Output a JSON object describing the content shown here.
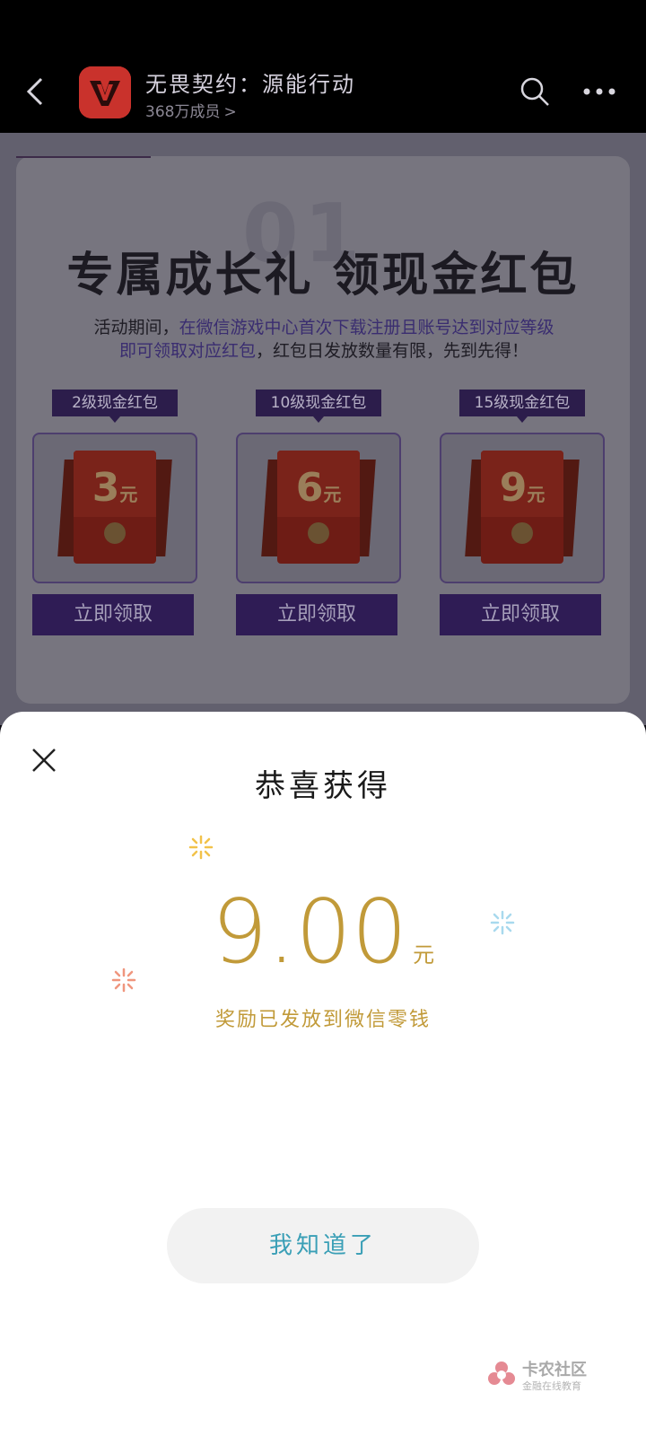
{
  "header": {
    "title": "无畏契约：源能行动",
    "members": "368万成员",
    "members_chevron": ">"
  },
  "event": {
    "big_number": "01",
    "title": "专属成长礼 领现金红包",
    "desc_prefix": "活动期间，",
    "desc_highlight_1": "在微信游戏中心首次下载注册且账号达到对应等级",
    "desc_highlight_2": "即可领取对应红包",
    "desc_suffix": "，红包日发放数量有限，先到先得！",
    "rewards": [
      {
        "tag": "2级现金红包",
        "amount": "3",
        "unit": "元",
        "button": "立即领取"
      },
      {
        "tag": "10级现金红包",
        "amount": "6",
        "unit": "元",
        "button": "立即领取"
      },
      {
        "tag": "15级现金红包",
        "amount": "9",
        "unit": "元",
        "button": "立即领取"
      }
    ]
  },
  "sheet": {
    "title": "恭喜获得",
    "amount": "9.00",
    "unit": "元",
    "subtitle": "奖励已发放到微信零钱",
    "ok_button": "我知道了"
  },
  "watermark": {
    "name": "卡农社区",
    "sub": "金融在线教育"
  },
  "colors": {
    "gold": "#c19a39",
    "teal": "#3a9fb6",
    "purple": "#2f1c55"
  }
}
